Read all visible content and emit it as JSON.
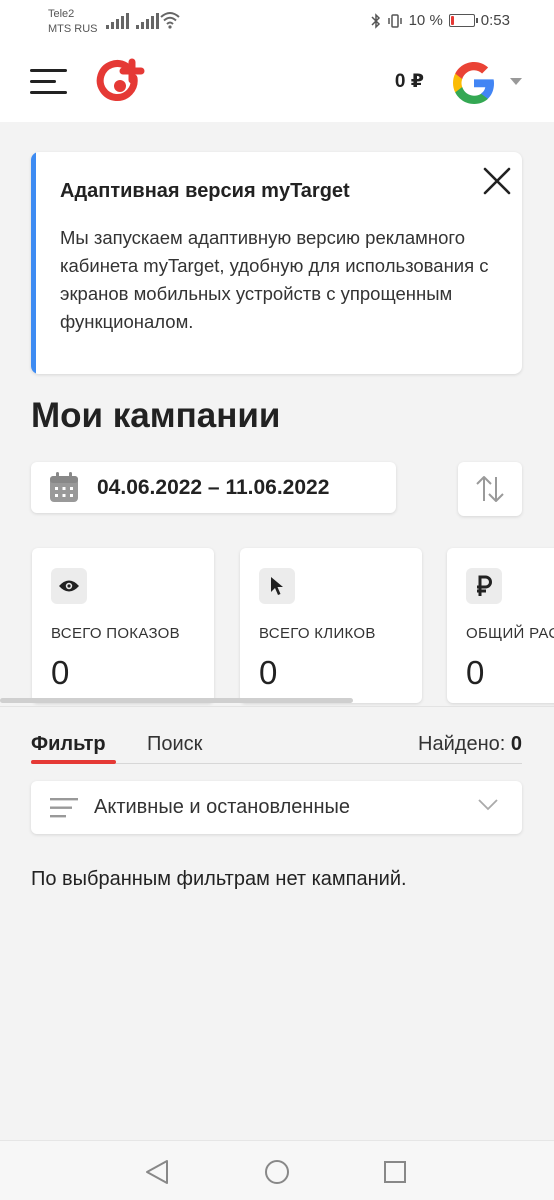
{
  "status_bar": {
    "carrier_1": "Tele2",
    "carrier_2": "MTS RUS",
    "battery_text": "10 %",
    "battery_level": 0.1,
    "time": "0:53"
  },
  "header": {
    "balance": "0 ₽",
    "icons": [
      "menu-icon",
      "mytarget-logo",
      "google-account-icon",
      "caret-down-icon"
    ]
  },
  "notice": {
    "title": "Адаптивная версия myTarget",
    "text": "Мы запускаем адаптивную версию рекламного кабинета myTarget, удобную для использования с экранов мобильных устройств с упрощенным функционалом.",
    "accent_color": "#3d8bf2"
  },
  "page": {
    "title": "Мои кампании"
  },
  "date_range": {
    "value": "04.06.2022 – 11.06.2022"
  },
  "stats": [
    {
      "icon": "eye-icon",
      "label": "ВСЕГО ПОКАЗОВ",
      "value": "0"
    },
    {
      "icon": "cursor-icon",
      "label": "ВСЕГО КЛИКОВ",
      "value": "0"
    },
    {
      "icon": "ruble-icon",
      "label": "ОБЩИЙ РАС",
      "value": "0"
    }
  ],
  "tabs": [
    {
      "label": "Фильтр",
      "active": true
    },
    {
      "label": "Поиск",
      "active": false
    }
  ],
  "found": {
    "label": "Найдено:",
    "count": "0"
  },
  "filter": {
    "selected": "Активные и остановленные"
  },
  "empty_message": "По выбранным фильтрам нет кампаний.",
  "colors": {
    "brand_red": "#e53935",
    "background": "#f3f3f3"
  }
}
